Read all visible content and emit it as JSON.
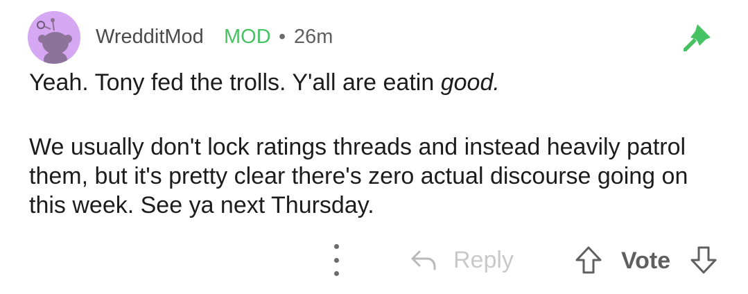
{
  "comment": {
    "author": "WredditMod",
    "badge": "MOD",
    "separator": "•",
    "time": "26m",
    "pinned_icon": "pin-icon",
    "paragraph1": {
      "text": "Yeah. Tony fed the trolls. Y'all are eatin ",
      "emphasis": "good."
    },
    "paragraph2": "We usually don't lock ratings threads and instead heavily patrol them, but it's pretty clear there's zero actual discourse going on this week. See ya next Thursday.",
    "actions": {
      "more_icon": "more-vertical-icon",
      "reply_label": "Reply",
      "reply_icon": "reply-arrow-icon",
      "vote_label": "Vote",
      "upvote_icon": "upvote-arrow-icon",
      "downvote_icon": "downvote-arrow-icon"
    }
  },
  "colors": {
    "avatar_bg": "#d6a7f2",
    "mod_green": "#46c263",
    "pin_green": "#46c263",
    "text": "#1c1c1c",
    "muted": "#5f5f62",
    "disabled": "#c9c9cc"
  }
}
